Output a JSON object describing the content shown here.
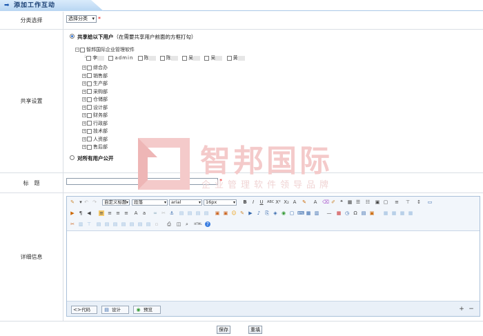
{
  "header": {
    "title": "添加工作互动"
  },
  "category": {
    "label": "分类选择",
    "select_value": "选择分类",
    "required": "*"
  },
  "share": {
    "label": "共享设置",
    "option1": "共享给以下用户",
    "option1_hint": "（在需要共享用户前面的方框打勾）",
    "option2": "对所有用户公开",
    "root": "智邦国际企业管理软件",
    "users": [
      "李",
      "admin",
      "陈",
      "陈",
      "吴",
      "吴",
      "黄"
    ],
    "departments": [
      "综合办",
      "销售部",
      "生产部",
      "采购部",
      "仓储部",
      "设计部",
      "财务部",
      "行政部",
      "技术部",
      "人资部",
      "售后部"
    ]
  },
  "title_field": {
    "label": "标　题",
    "required": "*"
  },
  "details": {
    "label": "详细信息",
    "toolbar": {
      "style_select": "自定义标题",
      "paragraph_select": "段落",
      "font_select": "arial",
      "size_select": "16px"
    },
    "modes": [
      "代码",
      "设计",
      "预览"
    ]
  },
  "watermark": {
    "brand": "智邦国际",
    "slogan": "企业管理软件领导品牌"
  },
  "actions": {
    "save": "保存",
    "reset": "重填"
  }
}
